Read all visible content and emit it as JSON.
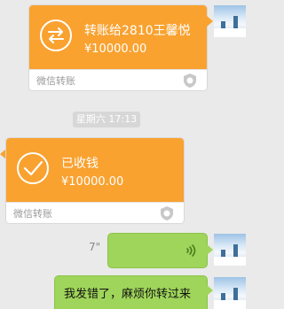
{
  "messages": {
    "transfer_sent": {
      "title": "转账给2810王馨悦",
      "amount": "¥10000.00",
      "footer": "微信转账",
      "icon": "transfer-arrows-icon"
    },
    "timestamp": "星期六 17:13",
    "transfer_received": {
      "title": "已收钱",
      "amount": "¥10000.00",
      "footer": "微信转账",
      "icon": "checkmark-icon"
    },
    "voice": {
      "duration": "7\"",
      "icon": "voice-wave-icon"
    },
    "text": "我发错了，麻烦你转过来"
  },
  "colors": {
    "transfer_orange": "#f9a230",
    "bubble_green": "#9fd55a",
    "background": "#eaeaea"
  }
}
